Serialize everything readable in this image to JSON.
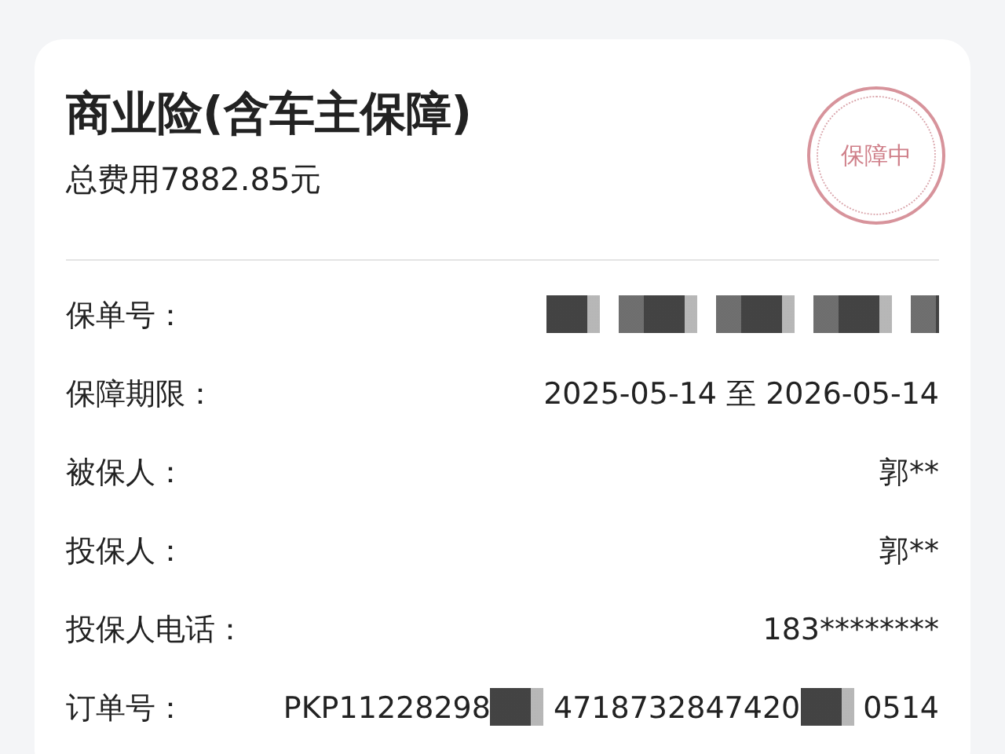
{
  "card": {
    "title": "商业险(含车主保障)",
    "total": "总费用7882.85元",
    "status_stamp": "保障中",
    "rows": [
      {
        "label": "保单号：",
        "value_parts": [
          {
            "kind": "redacted"
          }
        ]
      },
      {
        "label": "保障期限：",
        "value_parts": [
          {
            "kind": "text",
            "text": "2025-05-14 至 2026-05-14"
          }
        ]
      },
      {
        "label": "被保人：",
        "value_parts": [
          {
            "kind": "text",
            "text": "郭**"
          }
        ]
      },
      {
        "label": "投保人：",
        "value_parts": [
          {
            "kind": "text",
            "text": "郭**"
          }
        ]
      },
      {
        "label": "投保人电话：",
        "value_parts": [
          {
            "kind": "text",
            "text": "183********"
          }
        ]
      },
      {
        "label": "订单号：",
        "value_parts": [
          {
            "kind": "text",
            "text": "PKP11228298"
          },
          {
            "kind": "redacted"
          },
          {
            "kind": "text",
            "text": "4718732847420"
          },
          {
            "kind": "redacted"
          },
          {
            "kind": "text",
            "text": "0514"
          }
        ]
      }
    ]
  }
}
